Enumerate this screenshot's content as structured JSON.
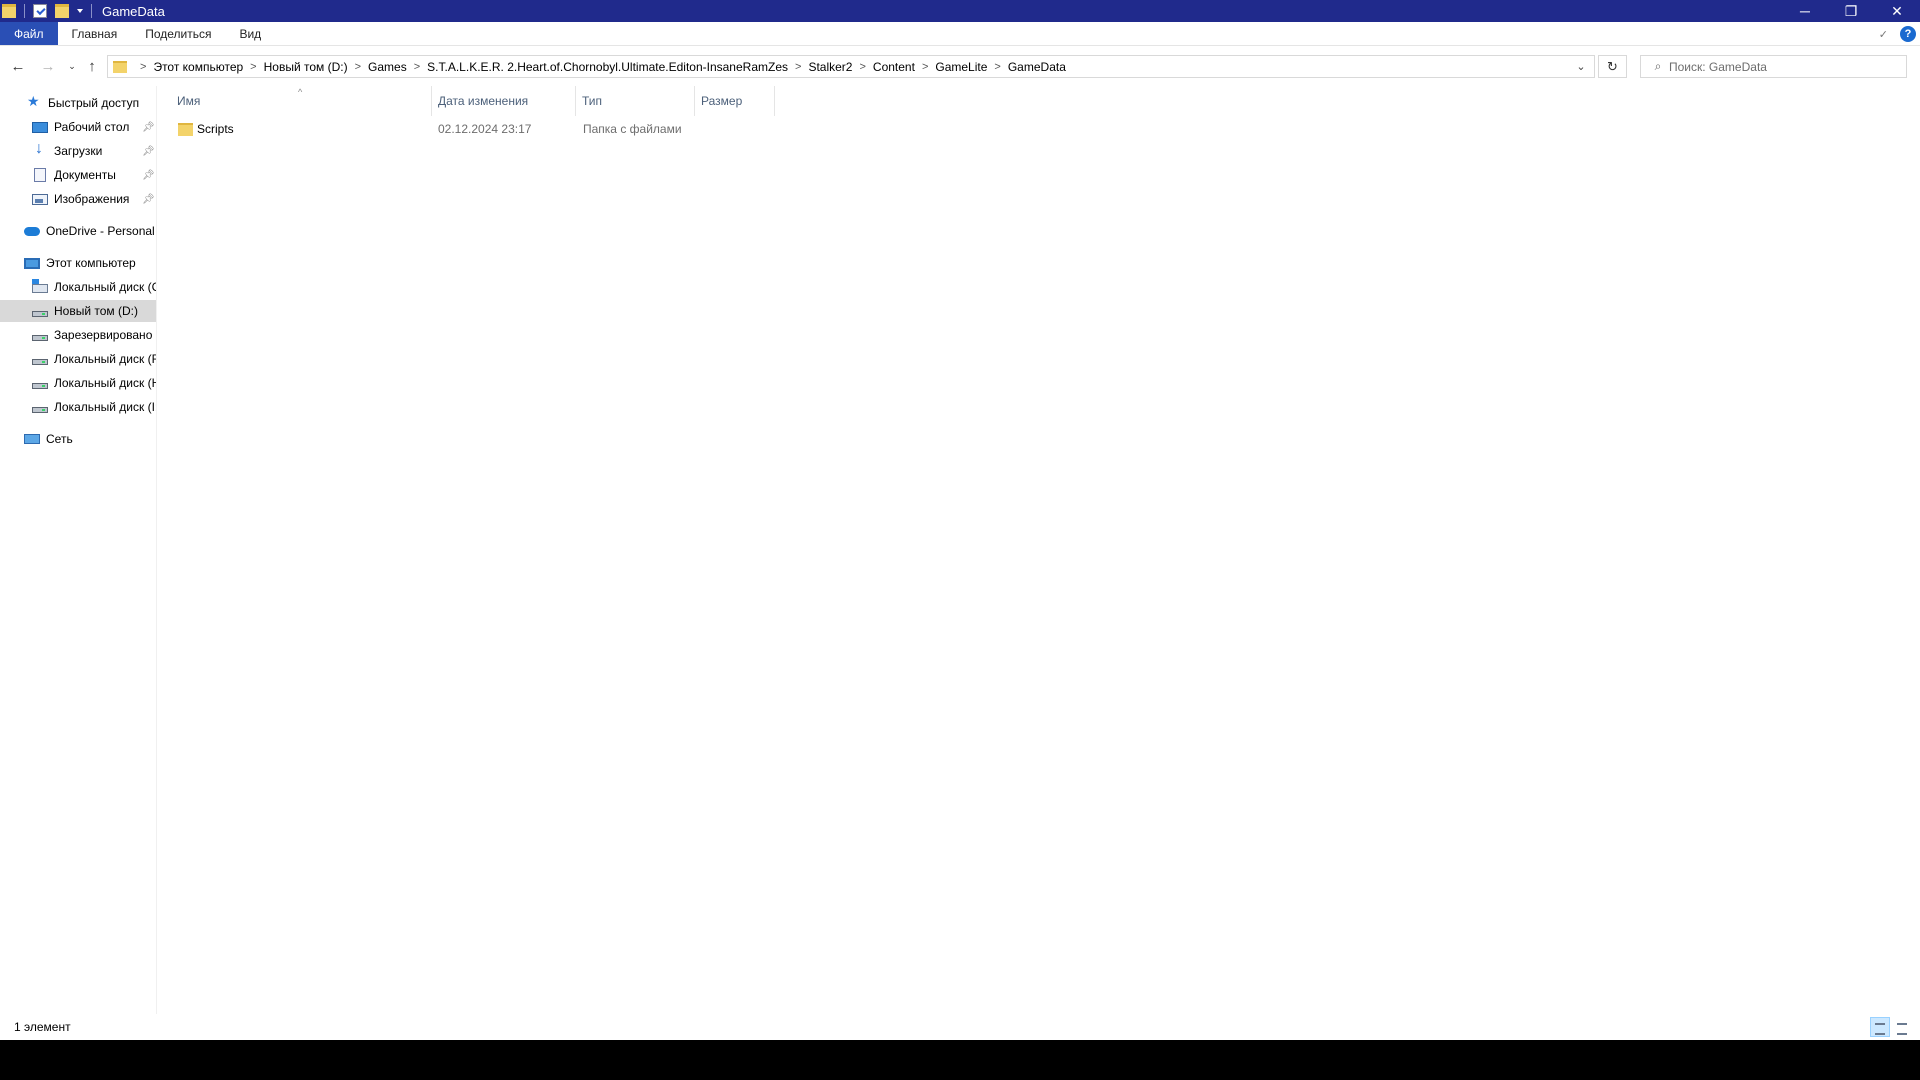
{
  "window": {
    "title": "GameData",
    "controls": {
      "minimize": "─",
      "restore": "❐",
      "close": "✕"
    }
  },
  "ribbon": {
    "tabs": [
      "Файл",
      "Главная",
      "Поделиться",
      "Вид"
    ],
    "help": "?"
  },
  "address": {
    "breadcrumbs": [
      "Этот компьютер",
      "Новый том (D:)",
      "Games",
      "S.T.A.L.K.E.R. 2.Heart.of.Chornobyl.Ultimate.Editon-InsaneRamZes",
      "Stalker2",
      "Content",
      "GameLite",
      "GameData"
    ],
    "search_placeholder": "Поиск: GameData"
  },
  "nav": {
    "quick_access": {
      "label": "Быстрый доступ",
      "items": [
        {
          "label": "Рабочий стол",
          "icon": "desktop-icon"
        },
        {
          "label": "Загрузки",
          "icon": "download-icon"
        },
        {
          "label": "Документы",
          "icon": "documents-icon"
        },
        {
          "label": "Изображения",
          "icon": "pictures-icon"
        }
      ]
    },
    "onedrive": "OneDrive - Personal",
    "this_pc": {
      "label": "Этот компьютер",
      "drives": [
        "Локальный диск (C",
        "Новый том (D:)",
        "Зарезервировано с",
        "Локальный диск (F",
        "Локальный диск (H",
        "Локальный диск (I:"
      ]
    },
    "network": "Сеть"
  },
  "columns": {
    "name": "Имя",
    "date": "Дата изменения",
    "type": "Тип",
    "size": "Размер"
  },
  "files": [
    {
      "name": "Scripts",
      "date": "02.12.2024 23:17",
      "type": "Папка с файлами",
      "size": ""
    }
  ],
  "status": {
    "count": "1 элемент"
  },
  "colors": {
    "titlebar": "#202a8c",
    "file_tab": "#2a4fb5",
    "selection": "#d9d9d9",
    "folder": "#f3d36a"
  }
}
